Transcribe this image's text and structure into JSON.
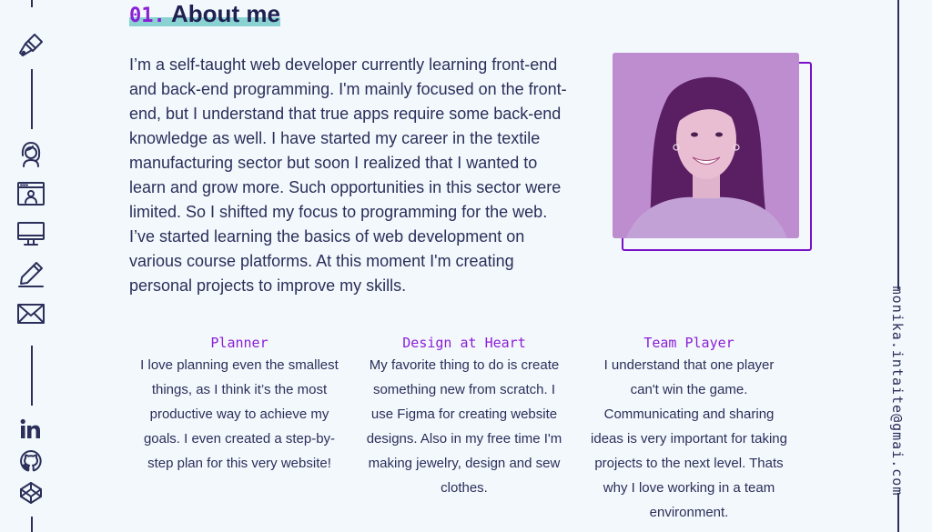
{
  "colors": {
    "accent": "#8a1fd6",
    "text": "#2b2f5a",
    "highlight": "#67c6c4",
    "background": "#f3f8fc"
  },
  "left_rail": {
    "nav_icons": [
      "brush-icon",
      "woman-avatar-icon",
      "browser-portfolio-icon",
      "desktop-monitor-icon",
      "pencil-icon",
      "mail-icon"
    ],
    "social_icons": [
      "linkedin-icon",
      "github-icon",
      "codepen-icon"
    ]
  },
  "section": {
    "number": "01.",
    "title": "About me",
    "intro": "I’m a self-taught web developer currently learning front-end and back-end programming. I'm mainly focused on the front-end, but I understand that true apps require some back-end knowledge as well. I have started my career in the textile manufacturing sector but soon I realized that I wanted to learn and grow more. Such opportunities in this sector were limited. So I shifted my focus to programming for the web. I’ve started learning the basics of web development on various course platforms. At this moment I'm creating personal projects to improve my skills."
  },
  "traits": [
    {
      "title": "Planner",
      "text": "I love planning even the smallest things, as I think it’s the most productive way to achieve my goals. I even created a step-by-step plan for this very website!"
    },
    {
      "title": "Design at Heart",
      "text": "My favorite thing to do is create something new from scratch. I use Figma for creating website designs. Also in my free time I'm making jewelry, design and sew clothes."
    },
    {
      "title": "Team Player",
      "text": "I understand that one player can't win the game. Communicating and sharing ideas is very important for taking projects to the next level. Thats why I love working in a team environment."
    }
  ],
  "email": "monika.intaite@gmai.com"
}
